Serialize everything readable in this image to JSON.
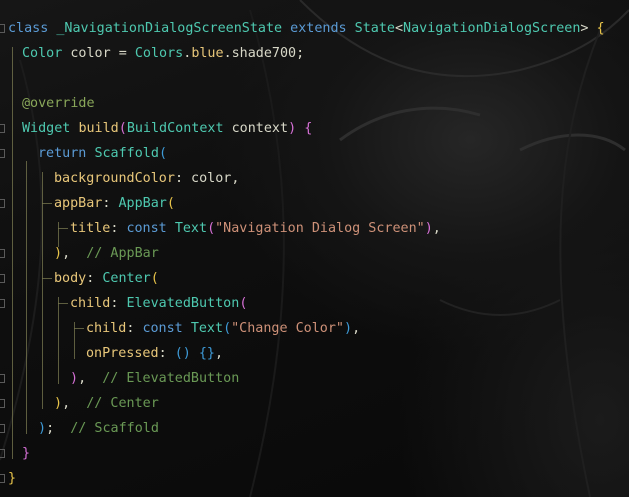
{
  "editor": {
    "language": "dart",
    "theme": "dark with anime artwork background",
    "colors": {
      "keyword": "#5b9bd5",
      "class": "#4ec9b0",
      "text": "#d8d8c8",
      "property": "#e8c77a",
      "string": "#ce9178",
      "comment": "#6a9955",
      "annotation": "#8aa85a",
      "bracket_level_1": "#e8c44a",
      "bracket_level_2": "#d670d6",
      "bracket_level_3": "#3e9bd8",
      "indent_guide": "#7a7a50"
    },
    "lines": [
      [
        [
          "kw",
          "class"
        ],
        [
          "plain",
          " "
        ],
        [
          "cls",
          "_NavigationDialogScreenState"
        ],
        [
          "plain",
          " "
        ],
        [
          "kw",
          "extends"
        ],
        [
          "plain",
          " "
        ],
        [
          "cls",
          "State"
        ],
        [
          "pun",
          "<"
        ],
        [
          "cls",
          "NavigationDialogScreen"
        ],
        [
          "pun",
          "> "
        ],
        [
          "brk1",
          "{"
        ]
      ],
      [
        [
          "cls",
          "Color"
        ],
        [
          "plain",
          " color = "
        ],
        [
          "cls",
          "Colors"
        ],
        [
          "pun",
          "."
        ],
        [
          "prop",
          "blue"
        ],
        [
          "pun",
          "."
        ],
        [
          "plain",
          "shade700;"
        ]
      ],
      [],
      [
        [
          "ann",
          "@override"
        ]
      ],
      [
        [
          "cls",
          "Widget"
        ],
        [
          "plain",
          " "
        ],
        [
          "prop",
          "build"
        ],
        [
          "brk2",
          "("
        ],
        [
          "cls",
          "BuildContext"
        ],
        [
          "plain",
          " context"
        ],
        [
          "brk2",
          ")"
        ],
        [
          "plain",
          " "
        ],
        [
          "brk2",
          "{"
        ]
      ],
      [
        [
          "kw",
          "return"
        ],
        [
          "plain",
          " "
        ],
        [
          "cls",
          "Scaffold"
        ],
        [
          "brk3",
          "("
        ]
      ],
      [
        [
          "prop",
          "backgroundColor"
        ],
        [
          "plain",
          ": color,"
        ]
      ],
      [
        [
          "prop",
          "appBar"
        ],
        [
          "plain",
          ": "
        ],
        [
          "cls",
          "AppBar"
        ],
        [
          "brk1",
          "("
        ]
      ],
      [
        [
          "prop",
          "title"
        ],
        [
          "plain",
          ": "
        ],
        [
          "kw",
          "const"
        ],
        [
          "plain",
          " "
        ],
        [
          "cls",
          "Text"
        ],
        [
          "brk2",
          "("
        ],
        [
          "str",
          "\"Navigation Dialog Screen\""
        ],
        [
          "brk2",
          ")"
        ],
        [
          "plain",
          ","
        ]
      ],
      [
        [
          "brk1",
          ")"
        ],
        [
          "plain",
          ",  "
        ],
        [
          "cmt",
          "// AppBar"
        ]
      ],
      [
        [
          "prop",
          "body"
        ],
        [
          "plain",
          ": "
        ],
        [
          "cls",
          "Center"
        ],
        [
          "brk1",
          "("
        ]
      ],
      [
        [
          "prop",
          "child"
        ],
        [
          "plain",
          ": "
        ],
        [
          "cls",
          "ElevatedButton"
        ],
        [
          "brk2",
          "("
        ]
      ],
      [
        [
          "prop",
          "child"
        ],
        [
          "plain",
          ": "
        ],
        [
          "kw",
          "const"
        ],
        [
          "plain",
          " "
        ],
        [
          "cls",
          "Text"
        ],
        [
          "brk3",
          "("
        ],
        [
          "str",
          "\"Change Color\""
        ],
        [
          "brk3",
          ")"
        ],
        [
          "plain",
          ","
        ]
      ],
      [
        [
          "prop",
          "onPressed"
        ],
        [
          "plain",
          ": "
        ],
        [
          "brk3",
          "()"
        ],
        [
          "plain",
          " "
        ],
        [
          "brk3",
          "{}"
        ],
        [
          "plain",
          ","
        ]
      ],
      [
        [
          "brk2",
          ")"
        ],
        [
          "plain",
          ",  "
        ],
        [
          "cmt",
          "// ElevatedButton"
        ]
      ],
      [
        [
          "brk1",
          ")"
        ],
        [
          "plain",
          ",  "
        ],
        [
          "cmt",
          "// Center"
        ]
      ],
      [
        [
          "brk3",
          ")"
        ],
        [
          "plain",
          ";  "
        ],
        [
          "cmt",
          "// Scaffold"
        ]
      ],
      [
        [
          "brk2",
          "}"
        ]
      ],
      [
        [
          "brk1",
          "}"
        ]
      ]
    ]
  }
}
